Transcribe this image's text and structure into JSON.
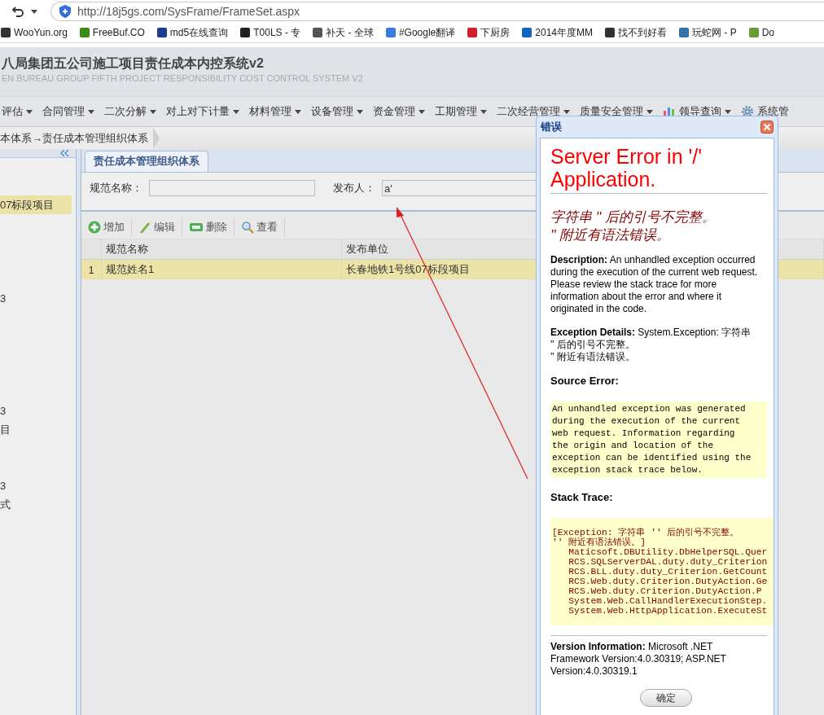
{
  "browser": {
    "url": "http://18j5gs.com/SysFrame/FrameSet.aspx",
    "bookmarks": [
      {
        "label": "WooYun.org"
      },
      {
        "label": "FreeBuf.CO"
      },
      {
        "label": "md5在线查询"
      },
      {
        "label": "T00LS - 专"
      },
      {
        "label": "补天 - 全球"
      },
      {
        "label": "#Google翻译"
      },
      {
        "label": "下厨房"
      },
      {
        "label": "2014年度MM"
      },
      {
        "label": "找不到好看"
      },
      {
        "label": "玩蛇网 - P"
      },
      {
        "label": "Do"
      }
    ]
  },
  "header": {
    "title": "八局集团五公司施工项目责任成本内控系统v2",
    "subtitle": "EN BUREAU GROUP FIFTH PROJECT RESPONSIBILITY COST CONTROL SYSTEM V2"
  },
  "menu": [
    {
      "label": "评估",
      "kind": "dropdown"
    },
    {
      "label": "合同管理",
      "kind": "dropdown"
    },
    {
      "label": "二次分解",
      "kind": "dropdown"
    },
    {
      "label": "对上对下计量",
      "kind": "dropdown"
    },
    {
      "label": "材料管理",
      "kind": "dropdown"
    },
    {
      "label": "设备管理",
      "kind": "dropdown"
    },
    {
      "label": "资金管理",
      "kind": "dropdown"
    },
    {
      "label": "工期管理",
      "kind": "dropdown"
    },
    {
      "label": "二次经营管理",
      "kind": "dropdown"
    },
    {
      "label": "质量安全管理",
      "kind": "dropdown"
    },
    {
      "label": "领导查询",
      "kind": "chart"
    },
    {
      "label": "系统管",
      "kind": "gear"
    }
  ],
  "breadcrumb": "本体系→责任成本管理组织体系",
  "sidebar": {
    "items": [
      {
        "label": "07标段项目",
        "selected": true
      },
      {
        "label": "3",
        "selected": false
      },
      {
        "label": "3",
        "selected": false
      },
      {
        "label": "目",
        "selected": false
      },
      {
        "label": "3",
        "selected": false
      },
      {
        "label": "式",
        "selected": false
      }
    ]
  },
  "panel": {
    "tabs": [
      {
        "label": "责任成本管理组织体系",
        "selected": true
      }
    ],
    "filters": [
      {
        "label": "规范名称："
      },
      {
        "label": "发布人：",
        "value": "a'"
      }
    ],
    "toolbar": [
      {
        "label": "增加",
        "kind": "add"
      },
      {
        "label": "编辑",
        "kind": "edit"
      },
      {
        "label": "删除",
        "kind": "delete"
      },
      {
        "label": "查看",
        "kind": "view"
      }
    ],
    "table": {
      "columns": [
        "规范名称",
        "发布单位"
      ],
      "rows": [
        {
          "number": "1",
          "cells": [
            "规范姓名1",
            "长春地铁1号线07标段项目"
          ],
          "selected": true
        }
      ]
    }
  },
  "dialog": {
    "title": "错误",
    "heading": "Server Error in '/' Application.",
    "message": "字符串 '' 后的引号不完整。\n'' 附近有语法错误。",
    "sections": [
      {
        "kind": "text",
        "label": "Description:",
        "text": "An unhandled exception occurred during the execution of the current web request. Please review the stack trace for more information about the error and where it originated in the code."
      },
      {
        "kind": "text",
        "label": "Exception Details:",
        "text": "System.Exception: 字符串\n'' 后的引号不完整。\n'' 附近有语法错误。"
      },
      {
        "kind": "code",
        "label": "Source Error:",
        "text": "An unhandled exception was generated\nduring the execution of the current\nweb request. Information regarding\nthe origin and location of the\nexception can be identified using the\nexception stack trace below."
      },
      {
        "kind": "stack",
        "label": "Stack Trace:",
        "text": "[Exception: 字符串 '' 后的引号不完整。\n'' 附近有语法错误。]\n   Maticsoft.DBUtility.DbHelperSQL.Quer\n   RCS.SQLServerDAL.duty.duty_Criterion\n   RCS.BLL.duty.duty_Criterion.GetCount\n   RCS.Web.duty.Criterion.DutyAction.Ge\n   RCS.Web.duty.Criterion.DutyAction.P\n   System.Web.CallHandlerExecutionStep.\n   System.Web.HttpApplication.ExecuteSt"
      },
      {
        "kind": "version",
        "label": "Version Information:",
        "text": "Microsoft .NET Framework Version:4.0.30319; ASP.NET Version:4.0.30319.1"
      }
    ],
    "button": "确定"
  }
}
